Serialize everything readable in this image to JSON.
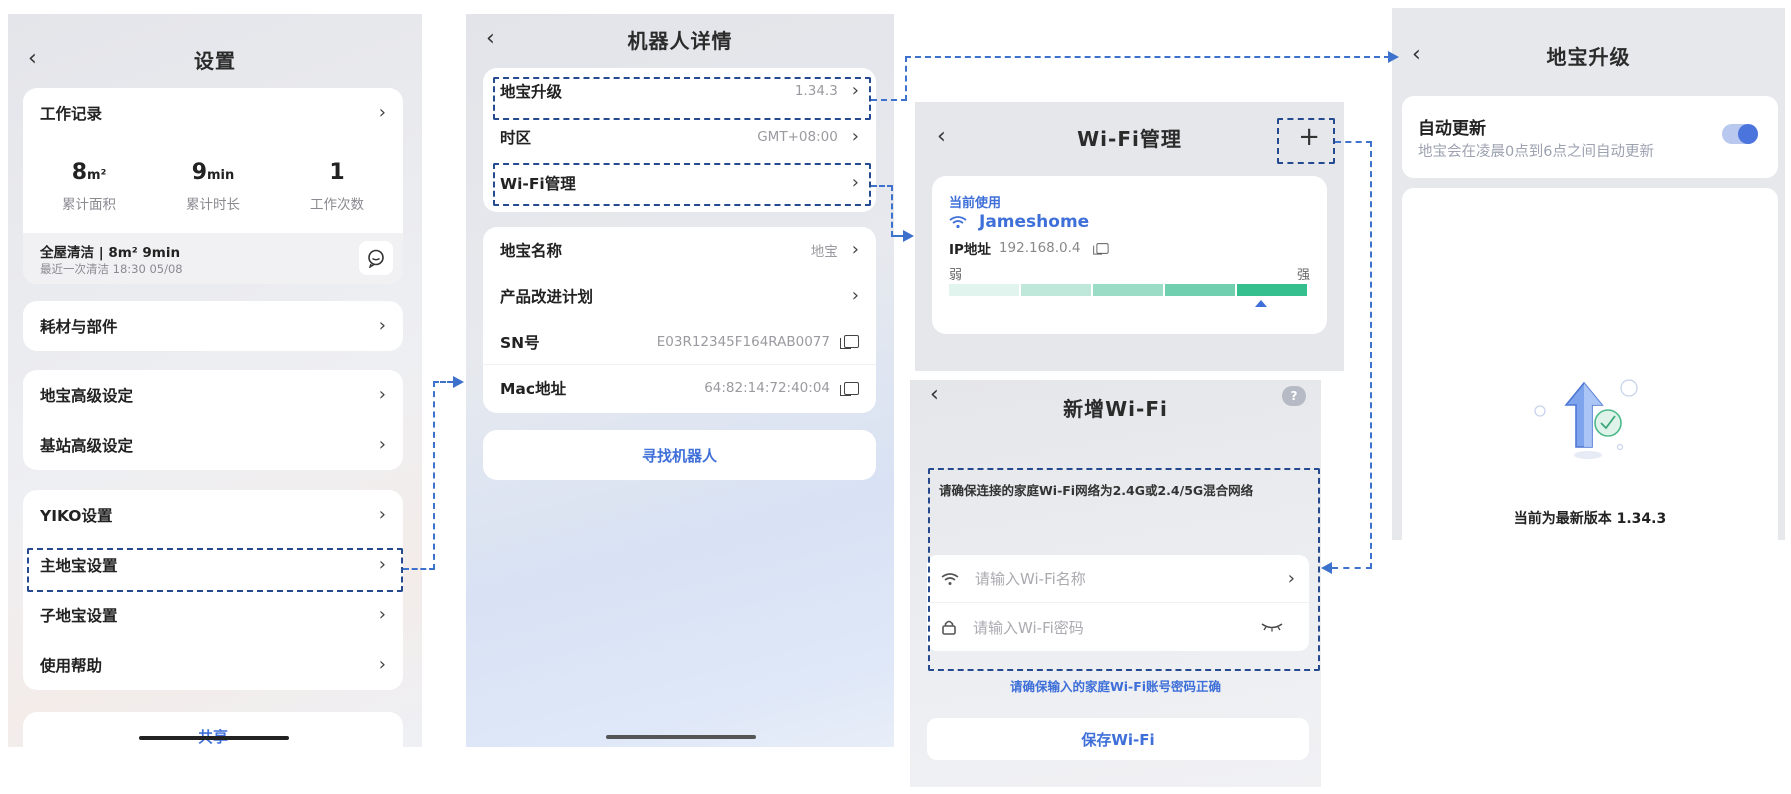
{
  "settings": {
    "title": "设置",
    "work_record": "工作记录",
    "stats": [
      {
        "num": "8",
        "unit": "m²",
        "cap": "累计面积"
      },
      {
        "num": "9",
        "unit": "min",
        "cap": "累计时长"
      },
      {
        "num": "1",
        "unit": "",
        "cap": "工作次数"
      }
    ],
    "last_clean_title": "全屋清洁 | 8m² 9min",
    "last_clean_time": "最近一次清洁 18:30 05/08",
    "consumables": "耗材与部件",
    "advanced": "地宝高级设定",
    "base_station": "基站高级设定",
    "yiko": "YIKO设置",
    "main_robot": "主地宝设置",
    "sub_robot": "子地宝设置",
    "help": "使用帮助",
    "share": "共享"
  },
  "details": {
    "title": "机器人详情",
    "upgrade": "地宝升级",
    "version": "1.34.3",
    "timezone": "时区",
    "timezone_value": "GMT+08:00",
    "wifi_manage": "Wi-Fi管理",
    "name": "地宝名称",
    "name_value": "地宝",
    "improve": "产品改进计划",
    "sn": "SN号",
    "sn_value": "E03R12345F164RAB0077",
    "mac": "Mac地址",
    "mac_value": "64:82:14:72:40:04",
    "find": "寻找机器人"
  },
  "wifi": {
    "title": "Wi-Fi管理",
    "current": "当前使用",
    "ssid": "Jameshome",
    "ip_label": "IP地址",
    "ip_value": "192.168.0.4",
    "weak": "弱",
    "strong": "强",
    "signal_level": 5,
    "signal_max": 5
  },
  "add_wifi": {
    "title": "新增Wi-Fi",
    "notice": "请确保连接的家庭Wi-Fi网络为2.4G或2.4/5G混合网络",
    "name_placeholder": "请输入Wi-Fi名称",
    "pwd_placeholder": "请输入Wi-Fi密码",
    "hint": "请确保输入的家庭Wi-Fi账号密码正确",
    "save": "保存Wi-Fi"
  },
  "upgrade": {
    "title": "地宝升级",
    "auto_update": "自动更新",
    "auto_update_desc": "地宝会在凌晨0点到6点之间自动更新",
    "auto_update_on": true,
    "latest": "当前为最新版本 1.34.3"
  },
  "colors": {
    "accent": "#3f6fd8",
    "dash": "#254a8f",
    "connector": "#3d72cc",
    "signal": [
      "#e2f4ee",
      "#bfe7da",
      "#9bdcc6",
      "#6fcfae",
      "#36bf8e"
    ]
  }
}
